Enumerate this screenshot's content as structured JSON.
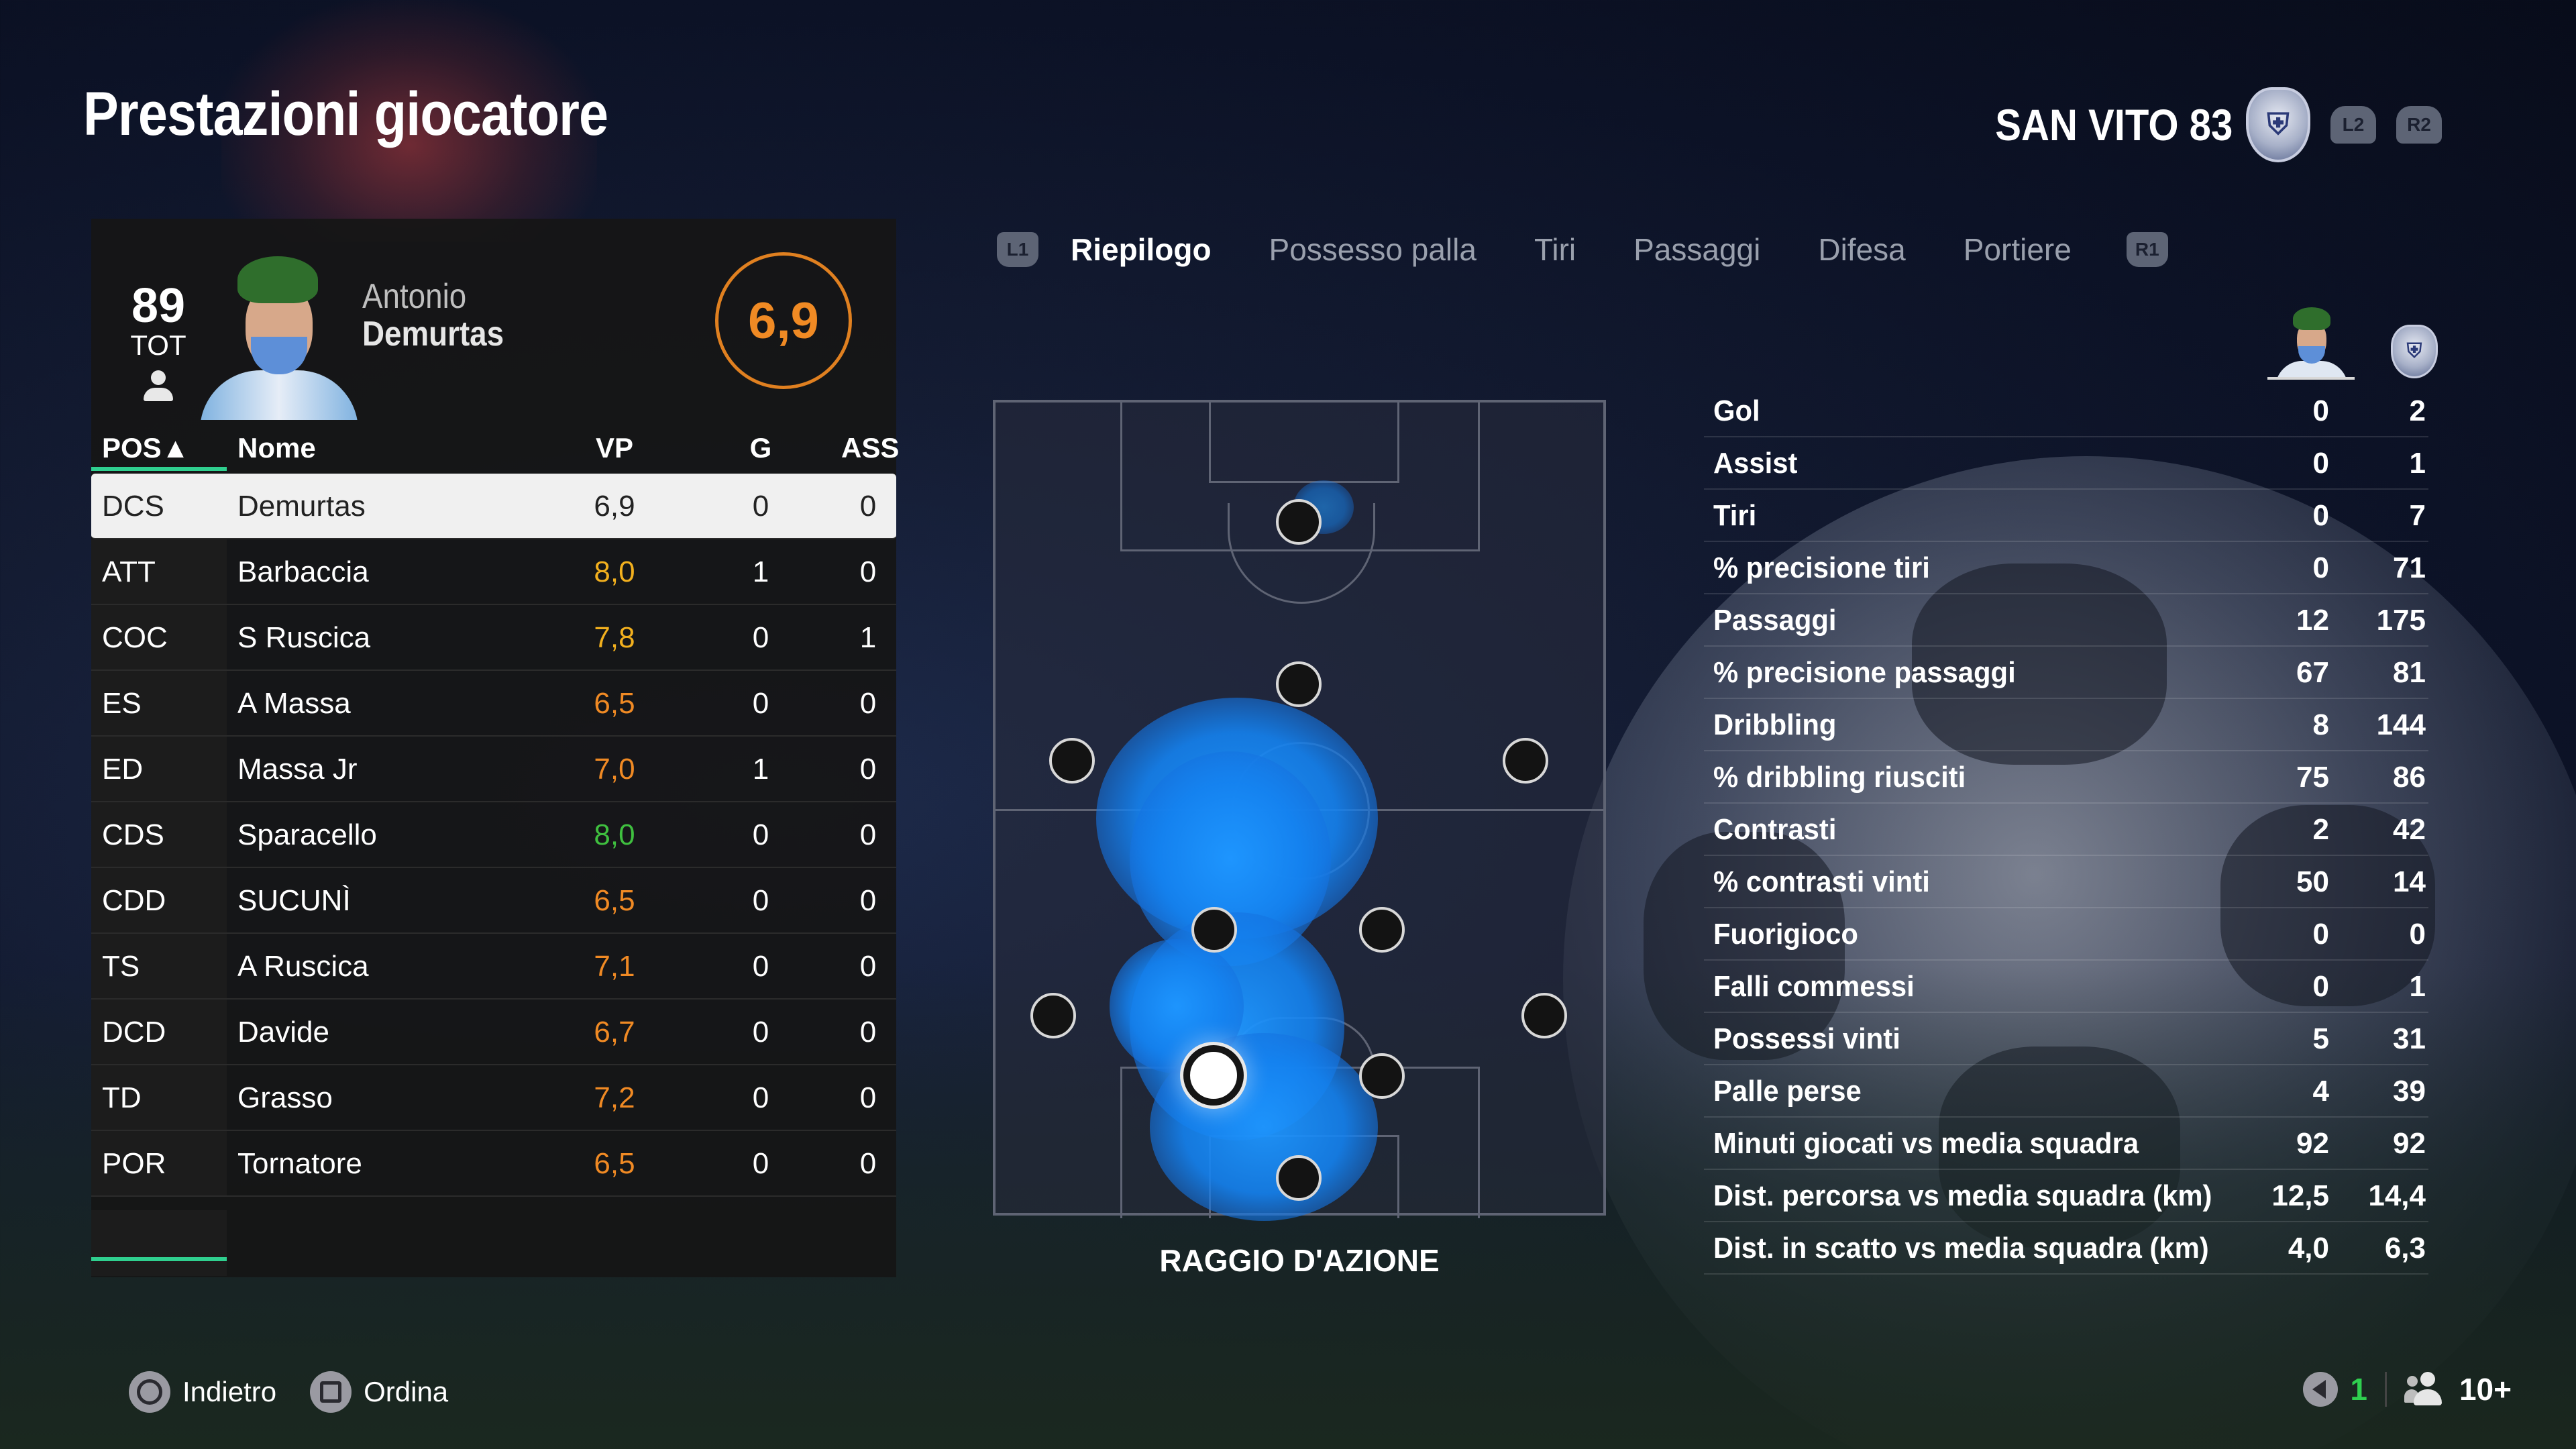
{
  "page_title": "Prestazioni giocatore",
  "club": {
    "name": "SAN VITO 83",
    "crest_icon": "club-crest-icon",
    "l2": "L2",
    "r2": "R2"
  },
  "player": {
    "overall": "89",
    "overall_label": "TOT",
    "first_name": "Antonio",
    "last_name": "Demurtas",
    "match_rating": "6,9"
  },
  "table": {
    "headers": {
      "pos": "POS▲",
      "name": "Nome",
      "vp": "VP",
      "g": "G",
      "ass": "ASS"
    },
    "rows": [
      {
        "pos": "DCS",
        "name": "Demurtas",
        "vp": "6,9",
        "g": "0",
        "ass": "0",
        "selected": true
      },
      {
        "pos": "ATT",
        "name": "Barbaccia",
        "vp": "8,0",
        "g": "1",
        "ass": "0"
      },
      {
        "pos": "COC",
        "name": "S  Ruscica",
        "vp": "7,8",
        "g": "0",
        "ass": "1"
      },
      {
        "pos": "ES",
        "name": "A Massa",
        "vp": "6,5",
        "g": "0",
        "ass": "0"
      },
      {
        "pos": "ED",
        "name": "Massa Jr",
        "vp": "7,0",
        "g": "1",
        "ass": "0"
      },
      {
        "pos": "CDS",
        "name": "Sparacello",
        "vp": "8,0",
        "g": "0",
        "ass": "0"
      },
      {
        "pos": "CDD",
        "name": "SUCUNÌ",
        "vp": "6,5",
        "g": "0",
        "ass": "0"
      },
      {
        "pos": "TS",
        "name": "A Ruscica",
        "vp": "7,1",
        "g": "0",
        "ass": "0"
      },
      {
        "pos": "DCD",
        "name": "Davide",
        "vp": "6,7",
        "g": "0",
        "ass": "0"
      },
      {
        "pos": "TD",
        "name": "Grasso",
        "vp": "7,2",
        "g": "0",
        "ass": "0"
      },
      {
        "pos": "POR",
        "name": "Tornatore",
        "vp": "6,5",
        "g": "0",
        "ass": "0"
      }
    ]
  },
  "rating_colors": {
    "orange": "#f08a24",
    "amber": "#f2b01e",
    "green": "#3fbf3f",
    "selected": "#222222"
  },
  "tabs": {
    "l1": "L1",
    "r1": "R1",
    "items": [
      "Riepilogo",
      "Possesso palla",
      "Tiri",
      "Passaggi",
      "Difesa",
      "Portiere"
    ],
    "active": "Riepilogo"
  },
  "pitch": {
    "caption": "RAGGIO D'AZIONE"
  },
  "stats": [
    {
      "label": "Gol",
      "player": "0",
      "team": "2"
    },
    {
      "label": "Assist",
      "player": "0",
      "team": "1"
    },
    {
      "label": "Tiri",
      "player": "0",
      "team": "7"
    },
    {
      "label": "% precisione tiri",
      "player": "0",
      "team": "71"
    },
    {
      "label": "Passaggi",
      "player": "12",
      "team": "175"
    },
    {
      "label": "% precisione passaggi",
      "player": "67",
      "team": "81"
    },
    {
      "label": "Dribbling",
      "player": "8",
      "team": "144"
    },
    {
      "label": "% dribbling riusciti",
      "player": "75",
      "team": "86"
    },
    {
      "label": "Contrasti",
      "player": "2",
      "team": "42"
    },
    {
      "label": "% contrasti vinti",
      "player": "50",
      "team": "14"
    },
    {
      "label": "Fuorigioco",
      "player": "0",
      "team": "0"
    },
    {
      "label": "Falli commessi",
      "player": "0",
      "team": "1"
    },
    {
      "label": "Possessi vinti",
      "player": "5",
      "team": "31"
    },
    {
      "label": "Palle perse",
      "player": "4",
      "team": "39"
    },
    {
      "label": "Minuti giocati vs media squadra",
      "player": "92",
      "team": "92"
    },
    {
      "label": "Dist. percorsa vs media squadra (km)",
      "player": "12,5",
      "team": "14,4"
    },
    {
      "label": "Dist. in scatto vs media squadra (km)",
      "player": "4,0",
      "team": "6,3"
    }
  ],
  "footer": {
    "back_label": "Indietro",
    "sort_label": "Ordina",
    "mic_count": "1",
    "players_count": "10+"
  }
}
